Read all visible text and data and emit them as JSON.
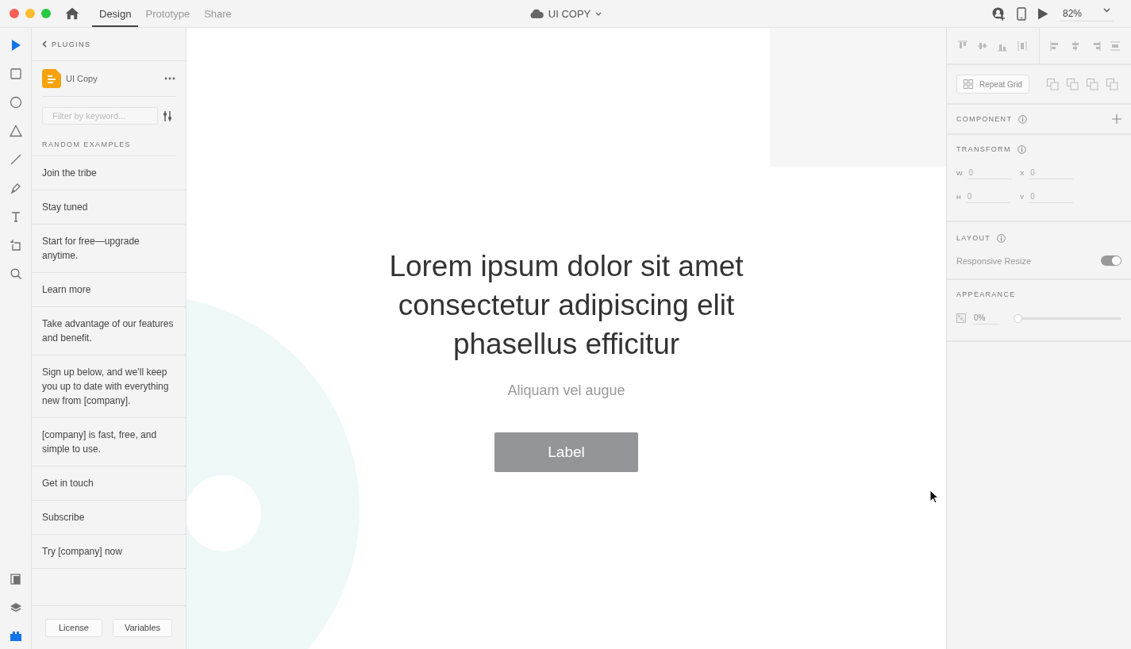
{
  "window": {
    "title": "UI COPY"
  },
  "tabs": [
    {
      "label": "Design",
      "selected": true
    },
    {
      "label": "Prototype",
      "selected": false
    },
    {
      "label": "Share",
      "selected": false
    }
  ],
  "zoom": "82%",
  "tools": [
    {
      "kind": "select",
      "selected": true
    },
    {
      "kind": "rectangle",
      "selected": false
    },
    {
      "kind": "ellipse",
      "selected": false
    },
    {
      "kind": "triangle",
      "selected": false
    },
    {
      "kind": "line",
      "selected": false
    },
    {
      "kind": "pen",
      "selected": false
    },
    {
      "kind": "text",
      "selected": false
    },
    {
      "kind": "artboard",
      "selected": false
    },
    {
      "kind": "zoom",
      "selected": false
    }
  ],
  "bottom_tools": [
    {
      "kind": "assets",
      "selected": false
    },
    {
      "kind": "layers",
      "selected": false
    },
    {
      "kind": "plugins",
      "selected": true
    }
  ],
  "plugins_panel": {
    "back_label": "PLUGINS",
    "plugin_name": "UI Copy",
    "filter": {
      "placeholder": "Filter by keyword..."
    },
    "section_title": "RANDOM EXAMPLES",
    "examples": [
      "Join the tribe",
      "Stay tuned",
      "Start for free—upgrade anytime.",
      "Learn more",
      "Take advantage of our features and benefit.",
      "Sign up below, and we’ll keep you up to date with everything new from [company].",
      "[company] is fast, free, and simple to use.",
      "Get in touch",
      "Subscribe",
      "Try [company] now"
    ],
    "buttons": [
      "License",
      "Variables"
    ]
  },
  "canvas": {
    "heading": "Lorem ipsum dolor sit amet consectetur adipiscing elit phasellus efficitur",
    "subheading": "Aliquam vel augue",
    "button": "Label"
  },
  "properties": {
    "repeat_grid": "Repeat Grid",
    "component_title": "COMPONENT",
    "transform_title": "TRANSFORM",
    "fields": [
      {
        "label": "W",
        "value": "0"
      },
      {
        "label": "X",
        "value": "0"
      },
      {
        "label": "H",
        "value": "0"
      },
      {
        "label": "Y",
        "value": "0"
      }
    ],
    "layout_title": "LAYOUT",
    "responsive": {
      "label": "Responsive Resize",
      "on": true
    },
    "appearance_title": "APPEARANCE",
    "opacity": {
      "value": "0%",
      "level": 0
    }
  }
}
